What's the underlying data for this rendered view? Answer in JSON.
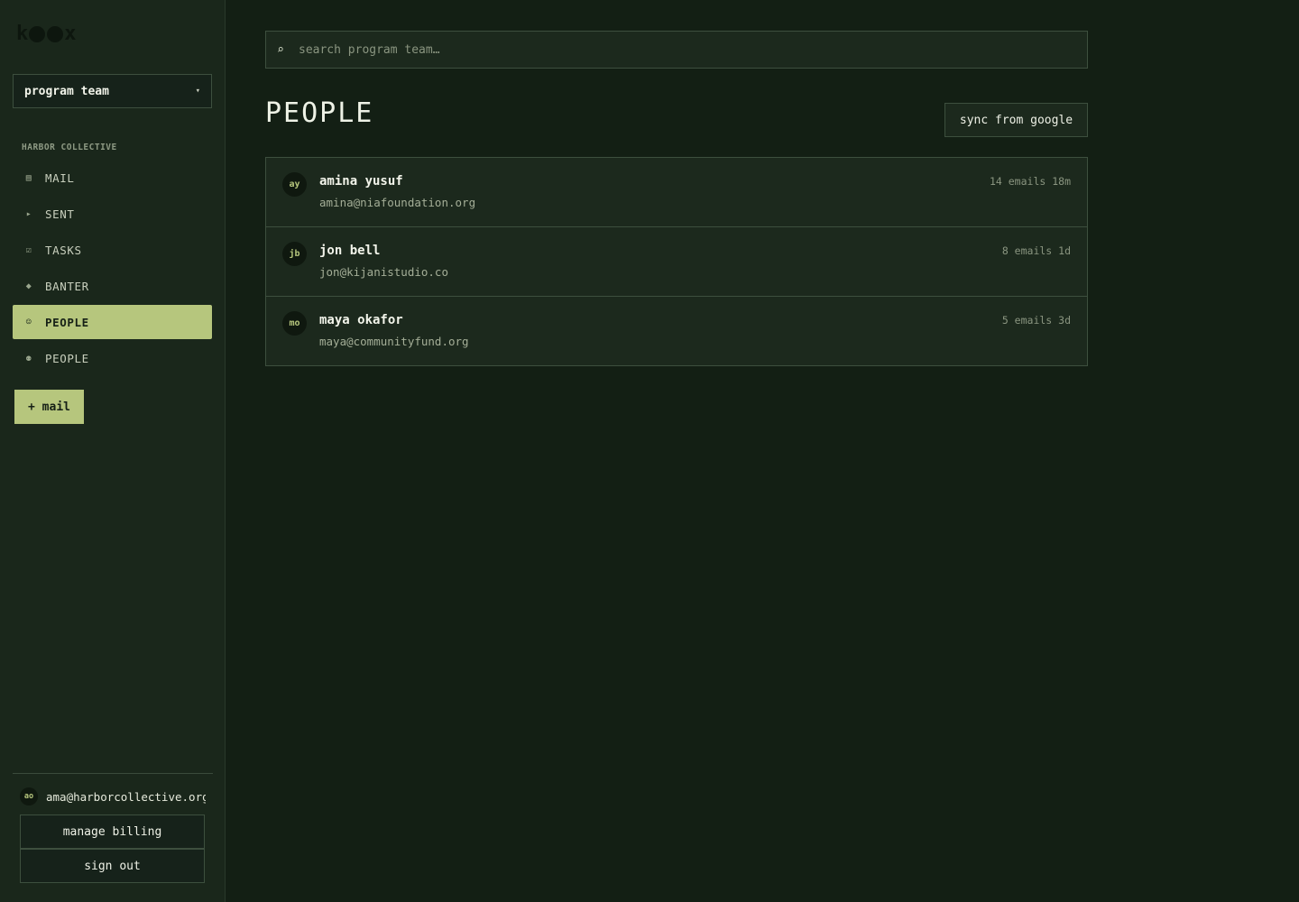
{
  "app": {
    "logo_text": "k●●x"
  },
  "sidebar": {
    "team_selector": {
      "value": "program team"
    },
    "org_label": "HARBOR COLLECTIVE",
    "items": [
      {
        "label": "MAIL",
        "icon": "inbox-icon",
        "glyph": "▤",
        "active": false
      },
      {
        "label": "SENT",
        "icon": "send-icon",
        "glyph": "▸",
        "active": false
      },
      {
        "label": "TASKS",
        "icon": "checkbox-icon",
        "glyph": "☑",
        "active": false
      },
      {
        "label": "BANTER",
        "icon": "diamond-icon",
        "glyph": "◆",
        "active": false
      },
      {
        "label": "PEOPLE",
        "icon": "smiley-icon",
        "glyph": "☺",
        "active": true
      },
      {
        "label": "PEOPLE",
        "icon": "group-icon",
        "glyph": "⚉",
        "active": false
      }
    ],
    "compose_label": "+ mail",
    "account": {
      "initials": "ao",
      "email": "ama@harborcollective.org"
    },
    "manage_billing_label": "manage billing",
    "sign_out_label": "sign out"
  },
  "main": {
    "search": {
      "placeholder": "search program team…",
      "value": ""
    },
    "title": "PEOPLE",
    "sync_label": "sync from google",
    "people": [
      {
        "initials": "ay",
        "name": "amina yusuf",
        "email": "amina@niafoundation.org",
        "meta": "14 emails 18m"
      },
      {
        "initials": "jb",
        "name": "jon bell",
        "email": "jon@kijanistudio.co",
        "meta": "8 emails 1d"
      },
      {
        "initials": "mo",
        "name": "maya okafor",
        "email": "maya@communityfund.org",
        "meta": "5 emails 3d"
      }
    ]
  },
  "colors": {
    "background": "#131f14",
    "sidebar": "#1a271b",
    "accent": "#b6c67d",
    "border": "#3d4f3e"
  }
}
